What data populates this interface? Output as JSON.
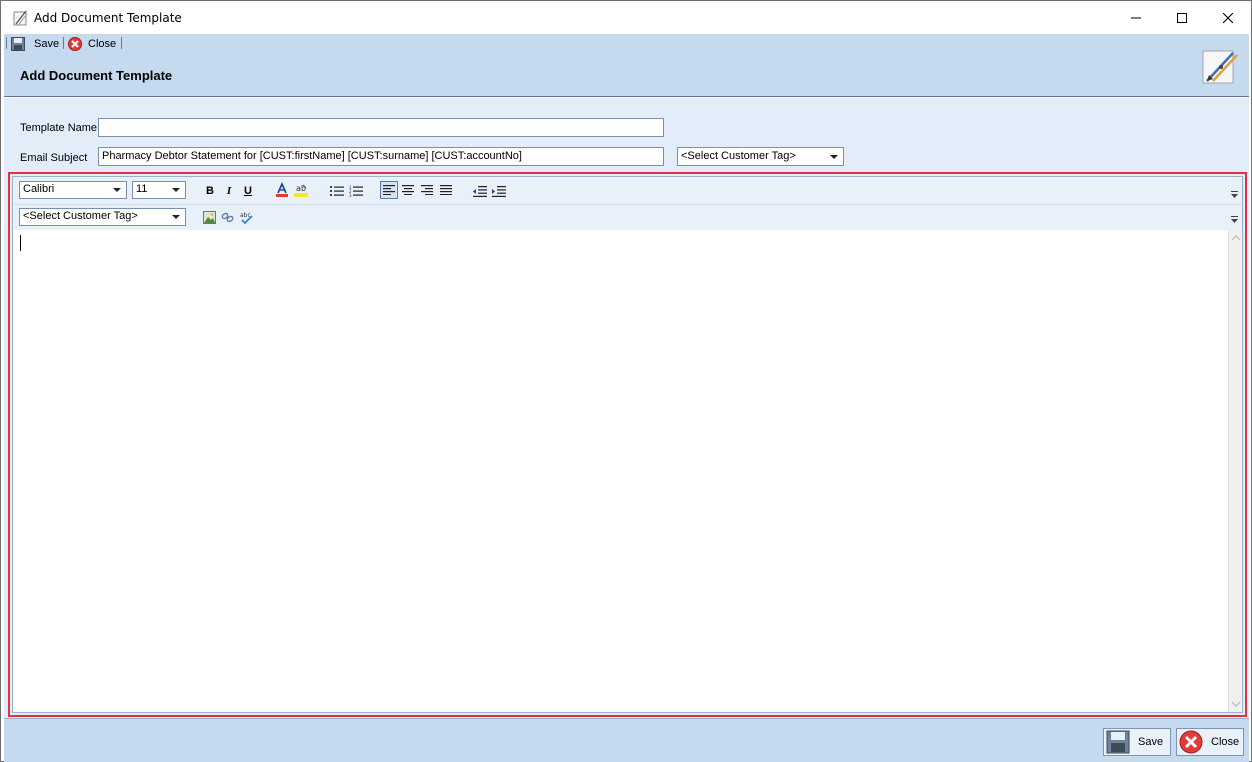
{
  "window": {
    "title": "Add Document Template"
  },
  "toolbar": {
    "save_label": "Save",
    "close_label": "Close"
  },
  "header": {
    "title": "Add Document Template"
  },
  "form": {
    "template_name_label": "Template Name",
    "template_name_value": "",
    "email_subject_label": "Email Subject",
    "email_subject_value": "Pharmacy Debtor Statement for [CUST:firstName] [CUST:surname] [CUST:accountNo]",
    "subject_tag_select": "<Select Customer Tag>"
  },
  "editor": {
    "font_family": "Calibri",
    "font_size": "11",
    "bold_label": "B",
    "italic_label": "I",
    "underline_label": "U",
    "tag_select": "<Select Customer Tag>",
    "content": ""
  },
  "footer": {
    "save_label": "Save",
    "close_label": "Close"
  },
  "colors": {
    "accent_band": "#c5d9ef",
    "form_bg": "#e2edf9",
    "highlight_frame": "#e0323f"
  }
}
